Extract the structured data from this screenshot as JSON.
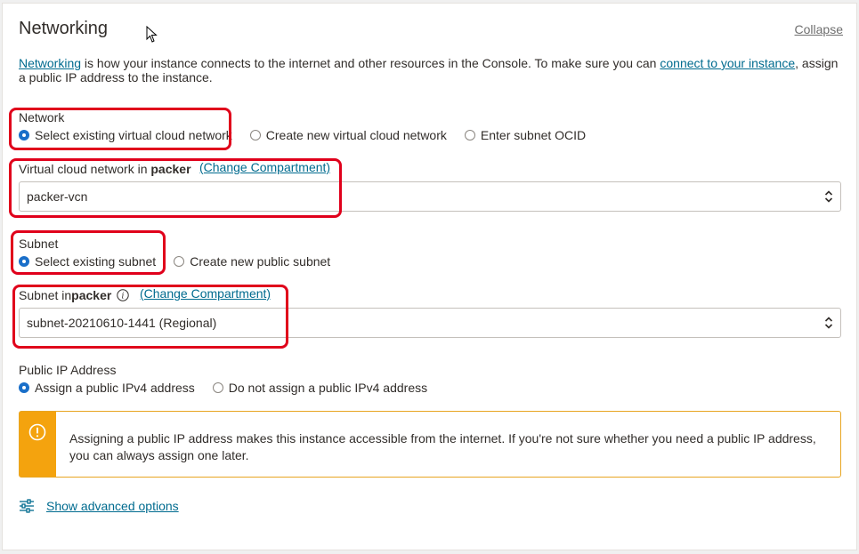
{
  "section": {
    "title": "Networking",
    "collapse_label": "Collapse"
  },
  "intro": {
    "link1": "Networking",
    "text1": " is how your instance connects to the internet and other resources in the Console. To make sure you can ",
    "link2": "connect to your instance",
    "text2": ", assign a public IP address to the instance."
  },
  "network": {
    "label": "Network",
    "options": [
      "Select existing virtual cloud network",
      "Create new virtual cloud network",
      "Enter subnet OCID"
    ],
    "selected_index": 0
  },
  "vcn": {
    "label_prefix": "Virtual cloud network in ",
    "compartment": "packer",
    "change_label": "(Change Compartment)",
    "value": "packer-vcn"
  },
  "subnet_choice": {
    "label": "Subnet",
    "options": [
      "Select existing subnet",
      "Create new public subnet"
    ],
    "selected_index": 0
  },
  "subnet": {
    "label_prefix": "Subnet in ",
    "compartment": "packer",
    "change_label": "(Change Compartment)",
    "value": "subnet-20210610-1441 (Regional)"
  },
  "public_ip": {
    "label": "Public IP Address",
    "options": [
      "Assign a public IPv4 address",
      "Do not assign a public IPv4 address"
    ],
    "selected_index": 0
  },
  "warning": {
    "text": "Assigning a public IP address makes this instance accessible from the internet. If you're not sure whether you need a public IP address, you can always assign one later."
  },
  "advanced": {
    "label": "Show advanced options"
  },
  "colors": {
    "accent": "#1a6fc9",
    "link": "#006b8f",
    "highlight": "#e0001b",
    "warning": "#f4a30e"
  }
}
